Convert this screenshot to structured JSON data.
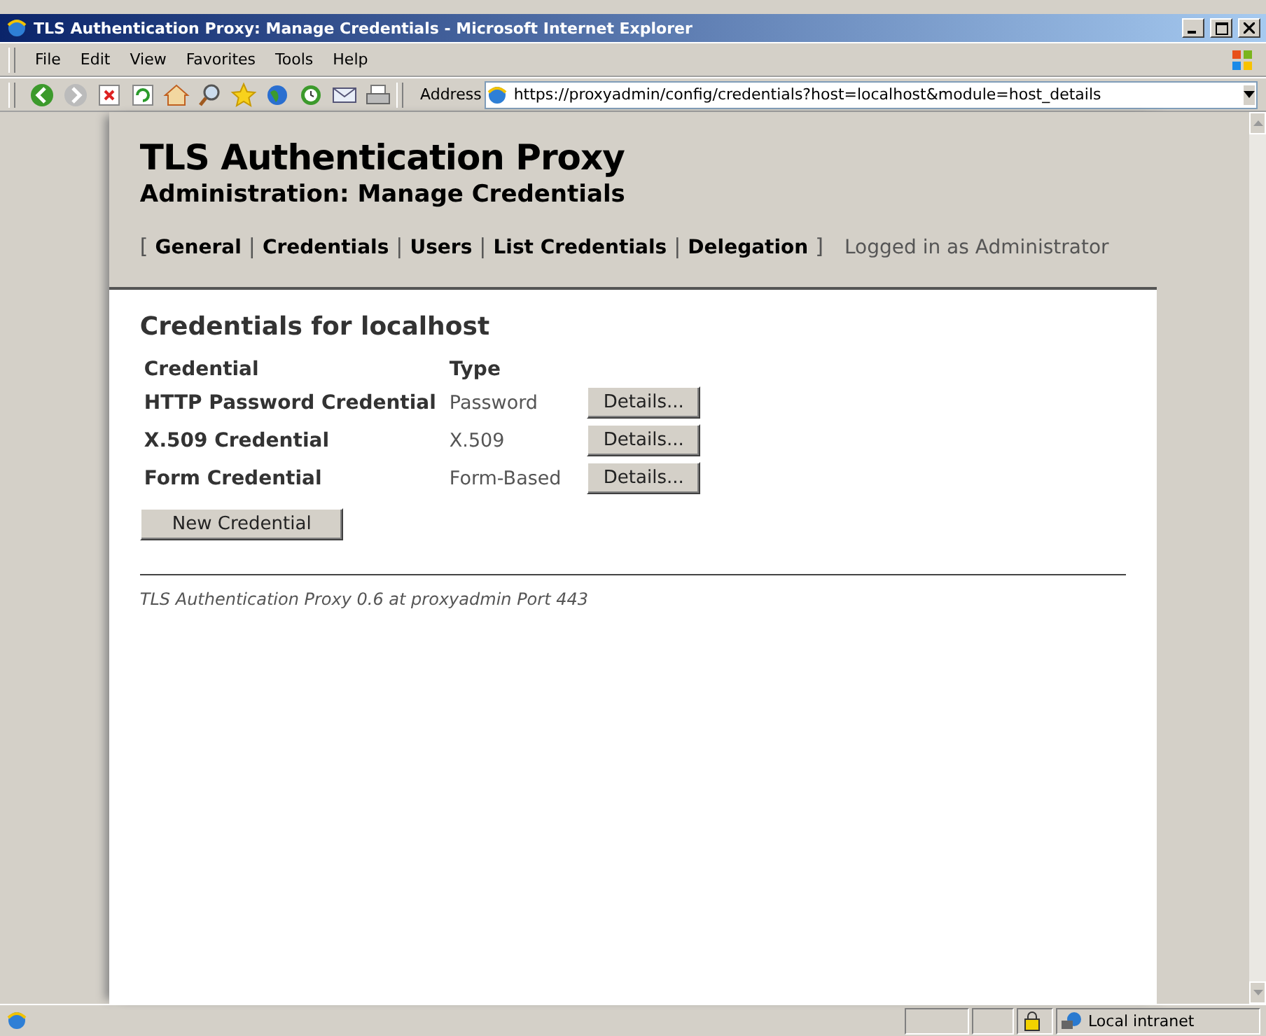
{
  "window": {
    "title": "TLS Authentication Proxy: Manage Credentials - Microsoft Internet Explorer"
  },
  "menu": [
    {
      "label": "File"
    },
    {
      "label": "Edit"
    },
    {
      "label": "View"
    },
    {
      "label": "Favorites"
    },
    {
      "label": "Tools"
    },
    {
      "label": "Help"
    }
  ],
  "address": {
    "label": "Address",
    "value": "https://proxyadmin/config/credentials?host=localhost&module=host_details"
  },
  "page": {
    "title": "TLS Authentication Proxy",
    "subtitle": "Administration: Manage Credentials",
    "nav": {
      "open": "[",
      "close": "]",
      "items": [
        {
          "label": "General"
        },
        {
          "label": "Credentials",
          "separator": "|"
        },
        {
          "label": "Users",
          "separator": "|"
        },
        {
          "label": "List Credentials",
          "separator": "|"
        },
        {
          "label": "Delegation",
          "separator": "|"
        }
      ]
    },
    "login": "Logged in as Administrator",
    "heading": "Credentials for localhost",
    "columns": [
      "Credential",
      "Type"
    ],
    "rows": [
      {
        "name": "HTTP Password Credential",
        "type": "Password",
        "button": "Details..."
      },
      {
        "name": "X.509 Credential",
        "type": "X.509",
        "button": "Details..."
      },
      {
        "name": "Form Credential",
        "type": "Form-Based",
        "button": "Details..."
      }
    ],
    "new_button": "New Credential",
    "footer": "TLS Authentication Proxy 0.6 at proxyadmin Port 443"
  },
  "status_bar": {
    "zone": "Local intranet"
  }
}
